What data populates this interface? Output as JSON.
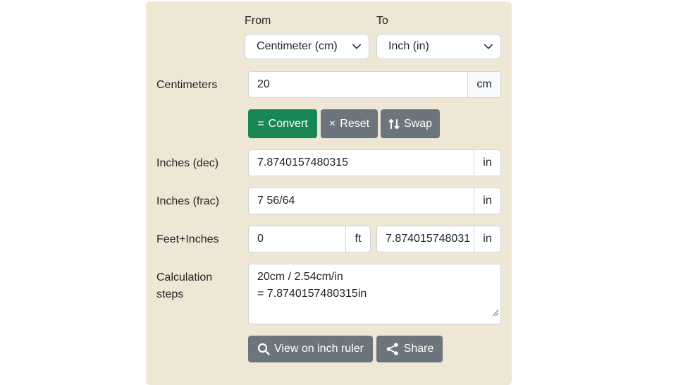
{
  "converter": {
    "from_label": "From",
    "to_label": "To",
    "from_unit": "Centimeter (cm)",
    "to_unit": "Inch (in)"
  },
  "input": {
    "label": "Centimeters",
    "value": "20",
    "unit": "cm"
  },
  "buttons": {
    "convert_label": "Convert",
    "convert_symbol": "=",
    "reset_label": "Reset",
    "reset_symbol": "×",
    "swap_label": "Swap",
    "view_ruler_label": "View on inch ruler",
    "share_label": "Share"
  },
  "results": {
    "dec_label": "Inches (dec)",
    "dec_value": "7.8740157480315",
    "dec_unit": "in",
    "frac_label": "Inches (frac)",
    "frac_value": "7 56/64",
    "frac_unit": "in",
    "feet_inches_label": "Feet+Inches",
    "feet_value": "0",
    "feet_unit": "ft",
    "inches_value": "7.874015748031",
    "inches_unit": "in"
  },
  "steps": {
    "label_line1": "Calculation",
    "label_line2": "steps",
    "line1": "20cm / 2.54cm/in",
    "line2": "= 7.8740157480315in"
  },
  "colors": {
    "panel_bg": "#efe7d5",
    "convert_green": "#198754",
    "button_gray": "#6c757d"
  },
  "icons": {
    "convert": "equals-icon",
    "reset": "times-icon",
    "swap": "swap-vertical-arrows-icon",
    "view_ruler": "search-icon",
    "share": "share-icon",
    "select": "chevron-down-icon"
  }
}
